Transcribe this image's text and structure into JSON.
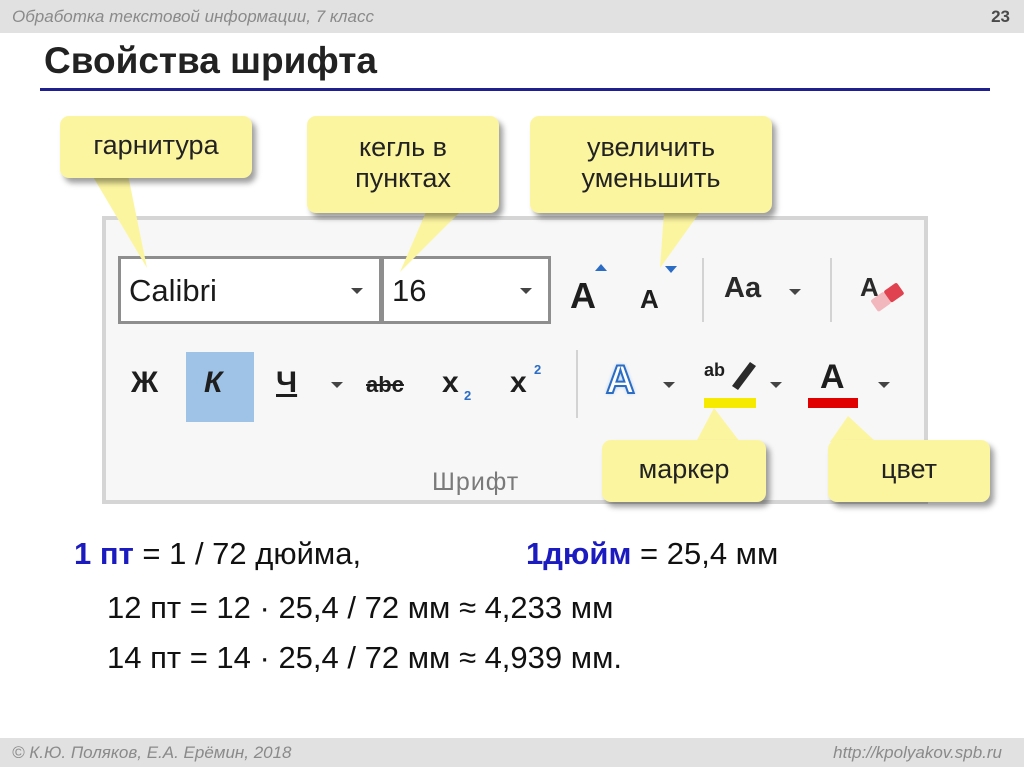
{
  "header": {
    "subject": "Обработка текстовой информации, 7 класс",
    "page": "23"
  },
  "title": "Свойства шрифта",
  "ribbon": {
    "font_name": "Calibri",
    "font_size": "16",
    "case_button": "Aa",
    "bold": "Ж",
    "italic": "К",
    "underline": "Ч",
    "strike": "abc",
    "sub": "x",
    "sub_mark": "2",
    "sup": "x",
    "sup_mark": "2",
    "effects_glyph": "A",
    "highlight_glyph": "ab",
    "color_glyph": "A",
    "group_label": "Шрифт",
    "highlight_color": "#f5ea00",
    "font_color": "#e00000"
  },
  "callouts": {
    "typeface": "гарнитура",
    "size_line1": "кегль в",
    "size_line2": "пунктах",
    "grow_line1": "увеличить",
    "grow_line2": "уменьшить",
    "marker": "маркер",
    "color": "цвет"
  },
  "formulas": {
    "l1_a": "1 пт",
    "l1_b": " = 1 / 72 дюйма,",
    "l1_c": "1дюйм",
    "l1_d": " = 25,4 мм",
    "l2": "12 пт = 12 · 25,4 / 72 мм ≈ 4,233 мм",
    "l3": "14 пт = 14 · 25,4 / 72 мм ≈ 4,939 мм."
  },
  "footer": {
    "authors": "© К.Ю. Поляков, Е.А. Ерёмин, 2018",
    "url": "http://kpolyakov.spb.ru"
  }
}
